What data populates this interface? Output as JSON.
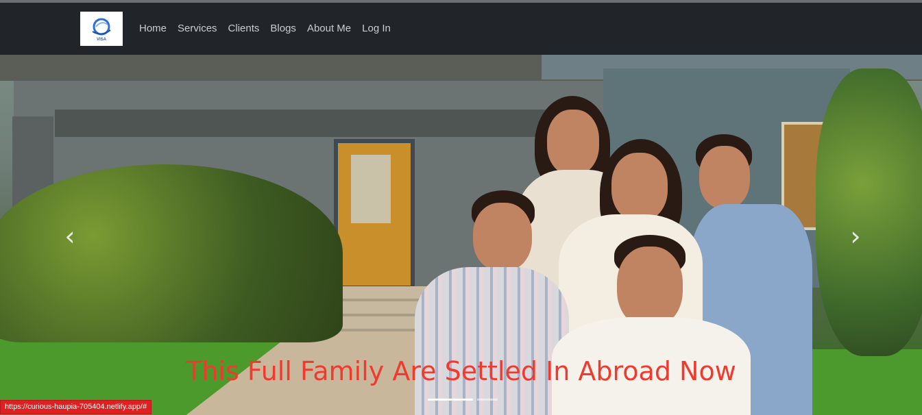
{
  "navbar": {
    "logo_text": "VISA",
    "links": [
      "Home",
      "Services",
      "Clients",
      "Blogs",
      "About Me",
      "Log In"
    ]
  },
  "carousel": {
    "caption": "This Full Family Are Settled In Abroad Now",
    "prev_glyph": "‹",
    "next_glyph": "›"
  },
  "status_bar": {
    "url": "https://curious-haupia-705404.netlify.app/#"
  },
  "colors": {
    "navbar_bg": "#212529",
    "caption_color": "#f03a2e",
    "status_bg": "#e02020"
  }
}
